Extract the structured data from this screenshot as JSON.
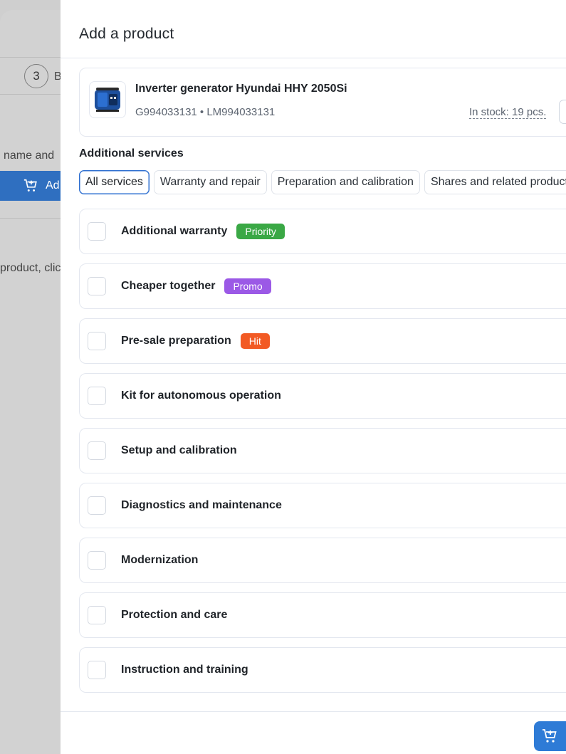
{
  "background": {
    "step_number": "3",
    "step_label": "B",
    "text_name": "name and",
    "add_button_label": "Ad",
    "text_product": "product, clic"
  },
  "modal": {
    "title": "Add a product",
    "product": {
      "name": "Inverter generator Hyundai HHY 2050Si",
      "codes": "G994033131 • LM994033131",
      "stock": "In stock: 19 pcs."
    },
    "services_title": "Additional services",
    "tabs": [
      {
        "label": "All services",
        "active": true
      },
      {
        "label": "Warranty and repair",
        "active": false
      },
      {
        "label": "Preparation and calibration",
        "active": false
      },
      {
        "label": "Shares and related products",
        "active": false
      }
    ],
    "services": [
      {
        "label": "Additional warranty",
        "badge": "Priority",
        "badge_color": "#3aa845"
      },
      {
        "label": "Cheaper together",
        "badge": "Promo",
        "badge_color": "#9b59e6"
      },
      {
        "label": "Pre-sale preparation",
        "badge": "Hit",
        "badge_color": "#f25a24"
      },
      {
        "label": "Kit for autonomous operation"
      },
      {
        "label": "Setup and calibration"
      },
      {
        "label": "Diagnostics and maintenance"
      },
      {
        "label": "Modernization"
      },
      {
        "label": "Protection and care"
      },
      {
        "label": "Instruction and training"
      }
    ],
    "footer_icon": "cart-add-icon"
  }
}
